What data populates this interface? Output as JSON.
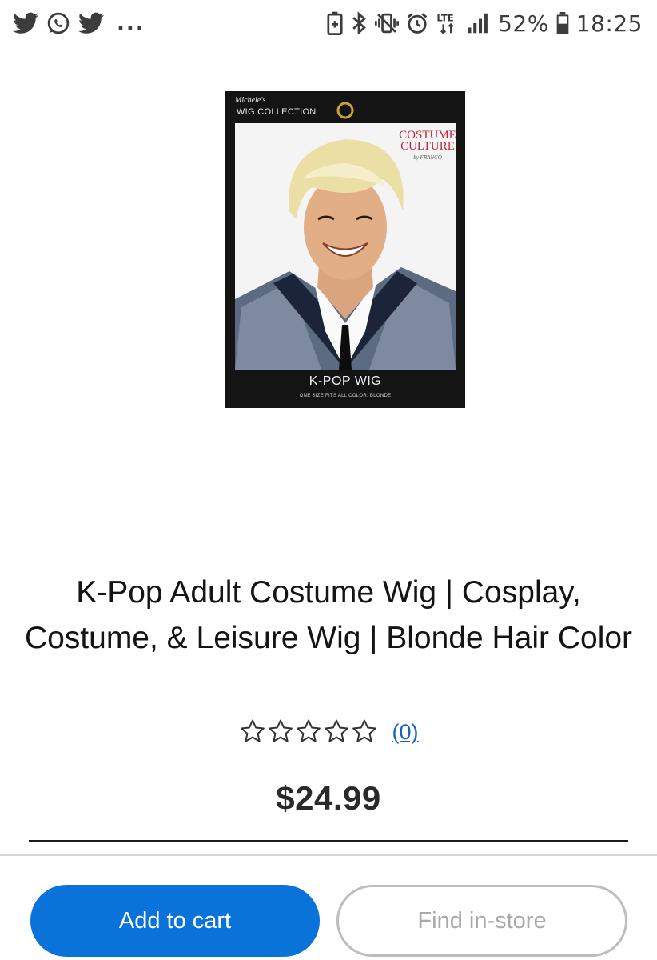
{
  "status_bar": {
    "left_icons": [
      "twitter-icon",
      "whatsapp-icon",
      "twitter-icon"
    ],
    "more": "...",
    "right_icons": [
      "battery-saver-icon",
      "bluetooth-icon",
      "vibrate-icon",
      "alarm-icon",
      "lte-icon",
      "signal-icon"
    ],
    "battery_percent": "52%",
    "time": "18:25"
  },
  "product": {
    "image": {
      "brand": "Michele's",
      "collection": "WIG COLLECTION",
      "logo_line1": "COSTUME",
      "logo_line2": "CULTURE",
      "logo_by": "by FRANCO",
      "package_name": "K-POP WIG",
      "package_details": "ONE SIZE FITS ALL   COLOR: BLONDE"
    },
    "title": "K-Pop Adult Costume Wig | Cosplay, Costume, & Leisure Wig | Blonde Hair Color",
    "rating": {
      "stars_filled": 0,
      "stars_total": 5,
      "review_count": "(0)"
    },
    "price": "$24.99"
  },
  "actions": {
    "add_to_cart": "Add to cart",
    "find_in_store": "Find in-store"
  },
  "colors": {
    "primary": "#0a73d9",
    "link": "#1565c0",
    "disabled_text": "#a9a9a9"
  }
}
